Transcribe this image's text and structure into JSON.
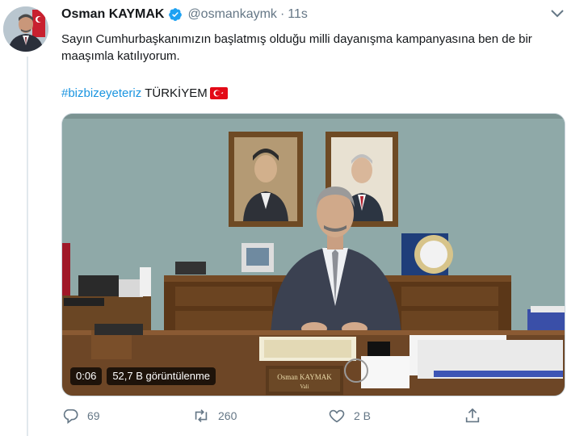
{
  "tweet": {
    "author_name": "Osman KAYMAK",
    "handle": "@osmankaymk",
    "separator": "·",
    "time": "11s",
    "text": "Sayın Cumhurbaşkanımızın başlatmış olduğu milli dayanışma kampanyasına ben de bir maaşımla katılıyorum.",
    "hashtag": "#bizbizeyeteriz",
    "tag_word": "TÜRKİYEM",
    "icons": {
      "verified": "verified-badge-icon",
      "more": "chevron-down-icon",
      "flag": "turkey-flag-icon"
    },
    "colors": {
      "accent": "#1b95e0",
      "secondary_text": "#657786"
    }
  },
  "video": {
    "duration": "0:06",
    "views": "52,7 B görüntülenme",
    "nameplate_name": "Osman KAYMAK",
    "nameplate_title": "Vali"
  },
  "actions": {
    "reply_count": "69",
    "retweet_count": "260",
    "like_count": "2 B",
    "icons": [
      "reply-icon",
      "retweet-icon",
      "like-icon",
      "share-icon"
    ]
  }
}
